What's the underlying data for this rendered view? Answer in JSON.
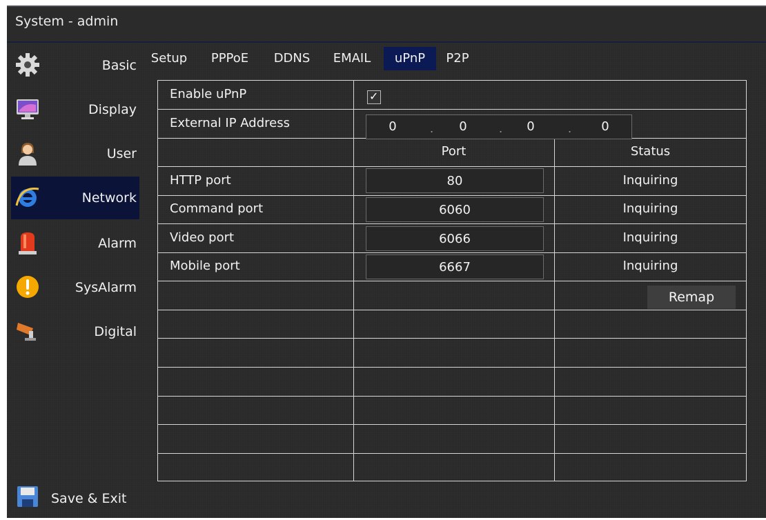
{
  "window": {
    "title": "System - admin"
  },
  "sidebar": {
    "items": [
      {
        "label": "Basic",
        "icon": "gear-icon"
      },
      {
        "label": "Display",
        "icon": "monitor-icon"
      },
      {
        "label": "User",
        "icon": "user-icon"
      },
      {
        "label": "Network",
        "icon": "internet-explorer-icon",
        "active": true
      },
      {
        "label": "Alarm",
        "icon": "siren-icon"
      },
      {
        "label": "SysAlarm",
        "icon": "warning-icon"
      },
      {
        "label": "Digital",
        "icon": "camera-icon"
      }
    ],
    "save_exit": {
      "label": "Save & Exit",
      "icon": "floppy-disk-icon"
    }
  },
  "tabs": [
    "Setup",
    "PPPoE",
    "DDNS",
    "EMAIL",
    "uPnP",
    "P2P"
  ],
  "active_tab": "uPnP",
  "form": {
    "enable_label": "Enable uPnP",
    "enable_checked": true,
    "checkmark": "✓",
    "external_ip_label": "External IP Address",
    "external_ip": [
      "0",
      "0",
      "0",
      "0"
    ],
    "ip_separator": ".",
    "port_header": "Port",
    "status_header": "Status",
    "ports": [
      {
        "label": "HTTP port",
        "port": "80",
        "status": "Inquiring"
      },
      {
        "label": "Command port",
        "port": "6060",
        "status": "Inquiring"
      },
      {
        "label": "Video port",
        "port": "6066",
        "status": "Inquiring"
      },
      {
        "label": "Mobile port",
        "port": "6667",
        "status": "Inquiring"
      }
    ],
    "remap_label": "Remap"
  },
  "colors": {
    "active_bg": "#0b1438",
    "tab_active_bg": "#0b1a55",
    "background": "#2a2a2a"
  }
}
